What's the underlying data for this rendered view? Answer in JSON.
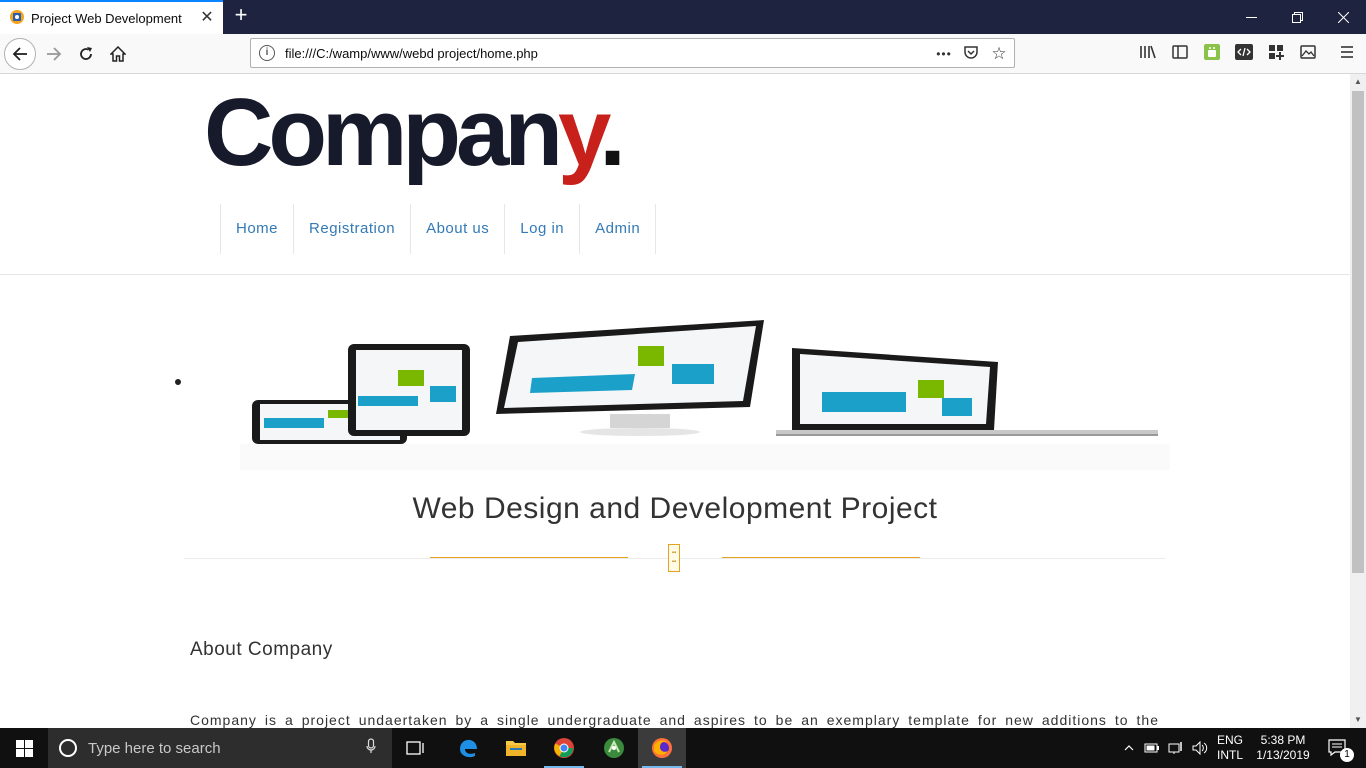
{
  "browser": {
    "tab_title": "Project Web Development",
    "tab_close": "✕",
    "new_tab": "+",
    "url": "file:///C:/wamp/www/webd project/home.php",
    "url_more": "•••"
  },
  "site": {
    "logo_main": "Compan",
    "logo_y": "y",
    "logo_dot": ".",
    "menu": [
      "Home",
      "Registration",
      "About us",
      "Log in",
      "Admin"
    ],
    "hero_title": "Web Design and Development Project",
    "about_heading": "About Company",
    "about_text": "Company is a project undaertaken by a single undergraduate and aspires to be an exemplary template for new additions to the"
  },
  "taskbar": {
    "search_placeholder": "Type here to search",
    "language": "ENG",
    "layout": "INTL",
    "time": "5:38 PM",
    "date": "1/13/2019",
    "notification_count": "1"
  },
  "colors": {
    "accent_link": "#337ab7",
    "gold": "#e4a21f",
    "logo_red": "#c8201a",
    "browser_dark": "#1e2340"
  }
}
